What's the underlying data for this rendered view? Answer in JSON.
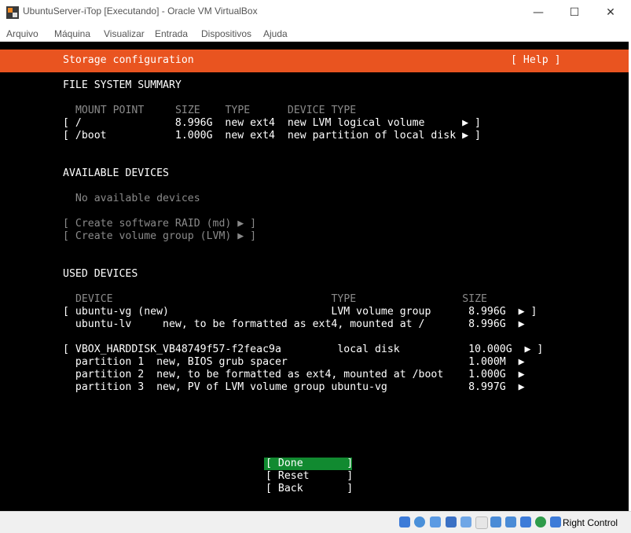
{
  "window": {
    "title": "UbuntuServer-iTop [Executando] - Oracle VM VirtualBox",
    "minimize": "—",
    "maximize": "☐",
    "close": "✕"
  },
  "menu": [
    "Arquivo",
    "Máquina",
    "Visualizar",
    "Entrada",
    "Dispositivos",
    "Ajuda"
  ],
  "installer": {
    "header_title": "Storage configuration",
    "help": "[ Help ]",
    "fs_summary_title": "FILE SYSTEM SUMMARY",
    "fs_columns": " MOUNT POINT     SIZE    TYPE      DEVICE TYPE",
    "fs_rows": [
      "[ /               8.996G  new ext4  new LVM logical volume      ▶ ]",
      "[ /boot           1.000G  new ext4  new partition of local disk ▶ ]"
    ],
    "available_title": "AVAILABLE DEVICES",
    "no_devices": "  No available devices",
    "create_raid": "[ Create software RAID (md) ▶ ]",
    "create_vg": "[ Create volume group (LVM) ▶ ]",
    "used_title": "USED DEVICES",
    "used_columns": " DEVICE                                   TYPE                 SIZE",
    "used_rows": [
      "[ ubuntu-vg (new)                          LVM volume group      8.996G  ▶ ]",
      "  ubuntu-lv     new, to be formatted as ext4, mounted at /       8.996G  ▶",
      "",
      "[ VBOX_HARDDISK_VB48749f57-f2feac9a         local disk           10.000G  ▶ ]",
      "  partition 1  new, BIOS grub spacer                             1.000M  ▶",
      "  partition 2  new, to be formatted as ext4, mounted at /boot    1.000G  ▶",
      "  partition 3  new, PV of LVM volume group ubuntu-vg             8.997G  ▶"
    ],
    "btn_done": "[ Done       ]",
    "btn_reset": "[ Reset      ]",
    "btn_back": "[ Back       ]"
  },
  "statusbar": {
    "host_key": "Right Control"
  }
}
